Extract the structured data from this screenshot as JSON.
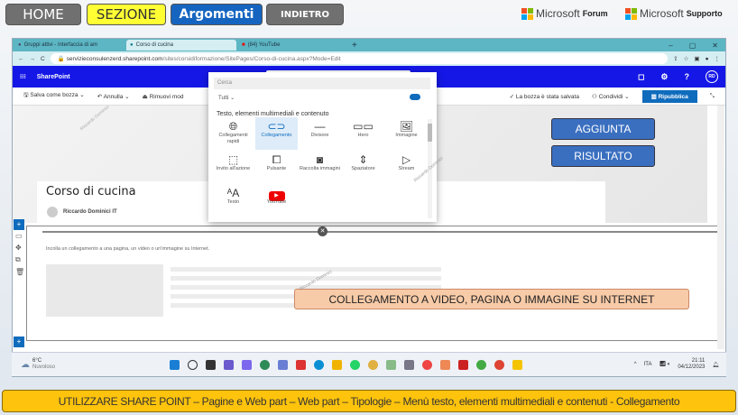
{
  "nav": {
    "home": "HOME",
    "sezione": "SEZIONE",
    "argomenti": "Argomenti",
    "indietro": "INDIETRO"
  },
  "ms_links": [
    {
      "brand": "Microsoft",
      "label": "Forum"
    },
    {
      "brand": "Microsoft",
      "label": "Supporto"
    }
  ],
  "browser": {
    "tabs": [
      "Gruppi attivi - Interfaccia di am",
      "Corso di cucina",
      "(84) YouTube"
    ],
    "url_host": "servizieconsulenzerd.sharepoint.com",
    "url_path": "/sites/corsidiformazione/SitePages/Corso-di-cucina.aspx?Mode=Edit"
  },
  "sharepoint": {
    "app": "SharePoint",
    "avatar": "RD"
  },
  "toolbar": {
    "save_draft": "Salva come bozza",
    "undo": "Annulla",
    "remove": "Rimuovi mod",
    "saved_status": "La bozza è stata salvata",
    "share": "Condividi",
    "republish": "Ripubblica"
  },
  "page": {
    "title": "Corso di cucina",
    "author": "Riccardo Dominici IT",
    "link_prompt": "Incolla un collegamento a una pagina, un video o un'immagine su Internet."
  },
  "toolbox": {
    "search_placeholder": "Cerca",
    "filter": "Tutti",
    "section": "Testo, elementi multimediali e contenuto",
    "items": [
      {
        "label": "Collegamenti rapidi",
        "icon": "globe"
      },
      {
        "label": "Collegamento",
        "icon": "link",
        "selected": true
      },
      {
        "label": "Divisore",
        "icon": "divider"
      },
      {
        "label": "Hero",
        "icon": "hero"
      },
      {
        "label": "Immagine",
        "icon": "image"
      },
      {
        "label": "Invito all'azione",
        "icon": "call-to-action"
      },
      {
        "label": "Pulsante",
        "icon": "button"
      },
      {
        "label": "Raccolta immagini",
        "icon": "gallery"
      },
      {
        "label": "Spaziatore",
        "icon": "spacer"
      },
      {
        "label": "Stream",
        "icon": "stream"
      },
      {
        "label": "Testo",
        "icon": "text"
      },
      {
        "label": "YouTube",
        "icon": "youtube"
      }
    ]
  },
  "watermark": "Riccardo Dominici",
  "callouts": {
    "aggiunta": "AGGIUNTA",
    "risultato": "RISULTATO",
    "collegamento": "COLLEGAMENTO A VIDEO, PAGINA O IMMAGINE SU INTERNET"
  },
  "taskbar": {
    "temp": "6°C",
    "weather": "Nuvoloso",
    "lang": "ITA",
    "time": "21:11",
    "date": "04/12/2023",
    "badge": "1"
  },
  "footer": "UTILIZZARE SHARE POINT – Pagine e Web part – Web part – Tipologie – Menù testo, elementi multimediali e contenuti - Collegamento",
  "colors": {
    "sharepoint_bar": "#1517e6",
    "accent": "#0f6cbd",
    "footer_bg": "#fec30c",
    "callout_blue": "#3a6fc0",
    "callout_orange": "#f8cba8"
  }
}
